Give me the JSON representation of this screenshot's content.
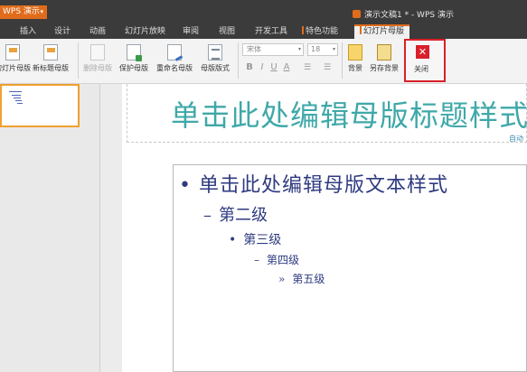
{
  "app": {
    "name": "WPS 演示",
    "document_title": "演示文稿1 * - WPS 演示"
  },
  "menu": {
    "items": [
      "插入",
      "设计",
      "动画",
      "幻灯片放映",
      "审阅",
      "视图",
      "开发工具",
      "特色功能",
      "幻灯片母版"
    ],
    "active": "幻灯片母版"
  },
  "ribbon": {
    "buttons": {
      "insert_master": "幻灯片母版",
      "new_title_master": "新标题母版",
      "delete_master": "删除母版",
      "protect_master": "保护母版",
      "rename_master": "重命名母版",
      "master_layout": "母版版式",
      "background": "背景",
      "save_background": "另存背景",
      "close": "关闭"
    },
    "font_name": "宋体",
    "font_size": "18",
    "format_buttons": {
      "bold": "B",
      "italic": "I",
      "underline": "U",
      "font_color": "A"
    },
    "close_icon_glyph": "✕"
  },
  "slide": {
    "title_placeholder": "单击此处编辑母版标题样式",
    "auto_label": "自动",
    "body_levels": [
      {
        "bullet": "•",
        "text": "单击此处编辑母版文本样式"
      },
      {
        "bullet": "–",
        "text": "第二级"
      },
      {
        "bullet": "•",
        "text": "第三级"
      },
      {
        "bullet": "–",
        "text": "第四级"
      },
      {
        "bullet": "»",
        "text": "第五级"
      }
    ]
  },
  "colors": {
    "accent_orange": "#e06c1b",
    "close_red": "#d9202a",
    "title_teal": "#3fa8a8",
    "body_navy": "#2f3b80"
  },
  "icons": {
    "insert_master": "slide-master-icon",
    "new_title_master": "new-title-master-icon",
    "delete_master": "delete-master-icon",
    "protect_master": "protect-master-icon",
    "rename_master": "rename-master-icon",
    "master_layout": "master-layout-icon",
    "background": "background-icon",
    "save_background": "save-background-icon",
    "close": "close-icon"
  }
}
